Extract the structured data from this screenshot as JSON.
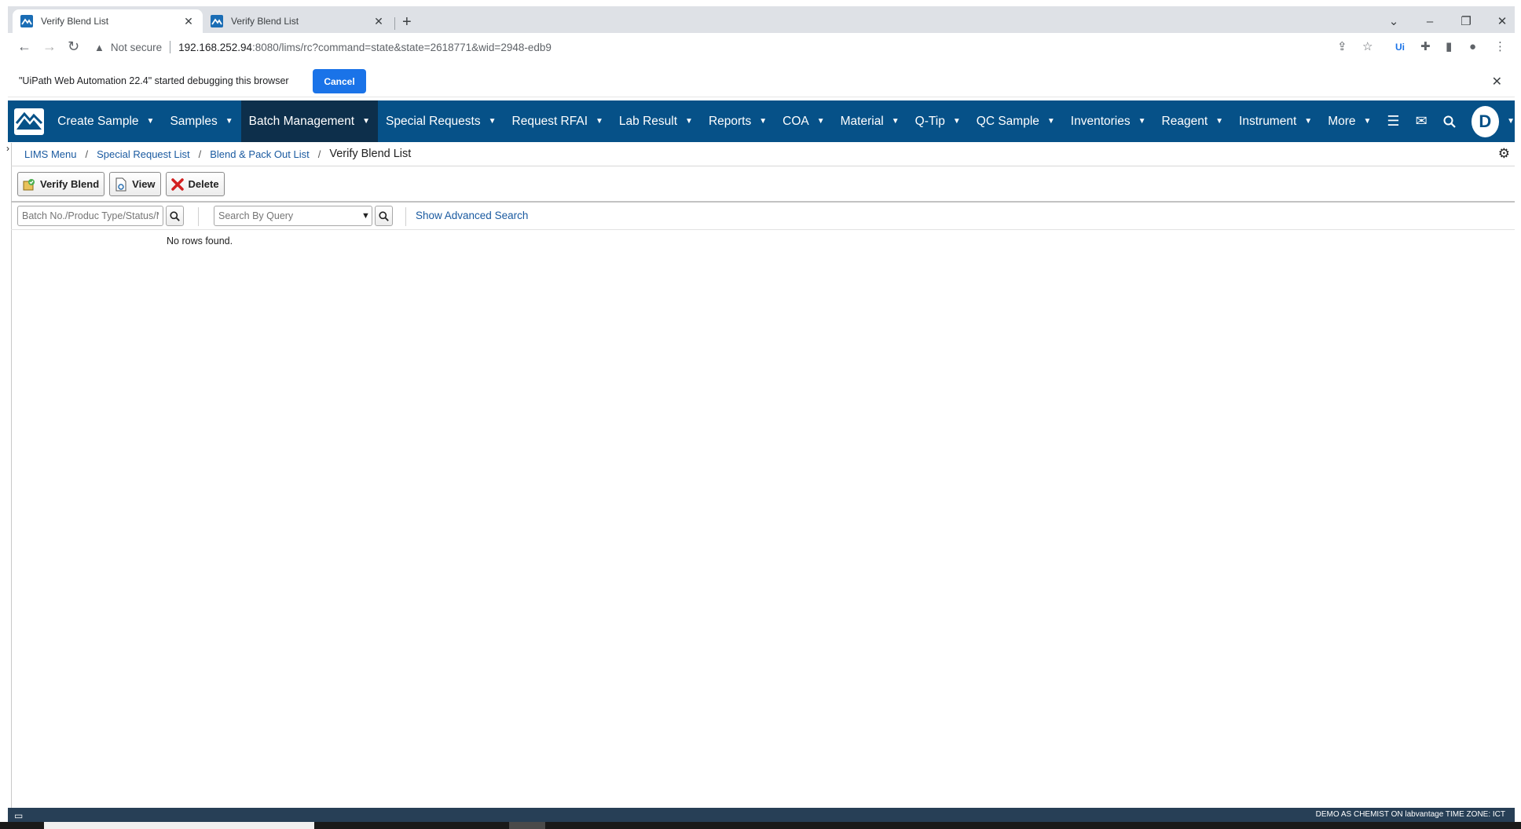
{
  "browser": {
    "tabs": [
      {
        "title": "Verify Blend List",
        "active": true
      },
      {
        "title": "Verify Blend List",
        "active": false
      }
    ],
    "address": {
      "security_label": "Not secure",
      "url_host": "192.168.252.94",
      "url_rest": ":8080/lims/rc?command=state&state=2618771&wid=2948-edb9"
    },
    "infobar": {
      "message": "\"UiPath Web Automation 22.4\" started debugging this browser",
      "cancel_label": "Cancel"
    }
  },
  "nav": {
    "items": [
      {
        "label": "Create Sample"
      },
      {
        "label": "Samples"
      },
      {
        "label": "Batch Management"
      },
      {
        "label": "Special Requests"
      },
      {
        "label": "Request RFAI"
      },
      {
        "label": "Lab Result"
      },
      {
        "label": "Reports"
      },
      {
        "label": "COA"
      },
      {
        "label": "Material"
      },
      {
        "label": "Q-Tip"
      },
      {
        "label": "QC Sample"
      },
      {
        "label": "Inventories"
      },
      {
        "label": "Reagent"
      },
      {
        "label": "Instrument"
      },
      {
        "label": "More"
      }
    ],
    "active_index": 2,
    "avatar_letter": "D",
    "bar_color": "#065188"
  },
  "breadcrumb": {
    "items": [
      "LIMS Menu",
      "Special Request List",
      "Blend & Pack Out List"
    ],
    "current": "Verify Blend List"
  },
  "toolbar": {
    "verify_label": "Verify Blend",
    "view_label": "View",
    "delete_label": "Delete"
  },
  "search": {
    "filter_placeholder": "Batch No./Produc Type/Status/M",
    "query_placeholder": "Search By Query",
    "advanced_label": "Show Advanced Search"
  },
  "results": {
    "empty_message": "No rows found."
  },
  "footer": {
    "status_text": "DEMO AS CHEMIST ON labvantage TIME ZONE: ICT"
  }
}
